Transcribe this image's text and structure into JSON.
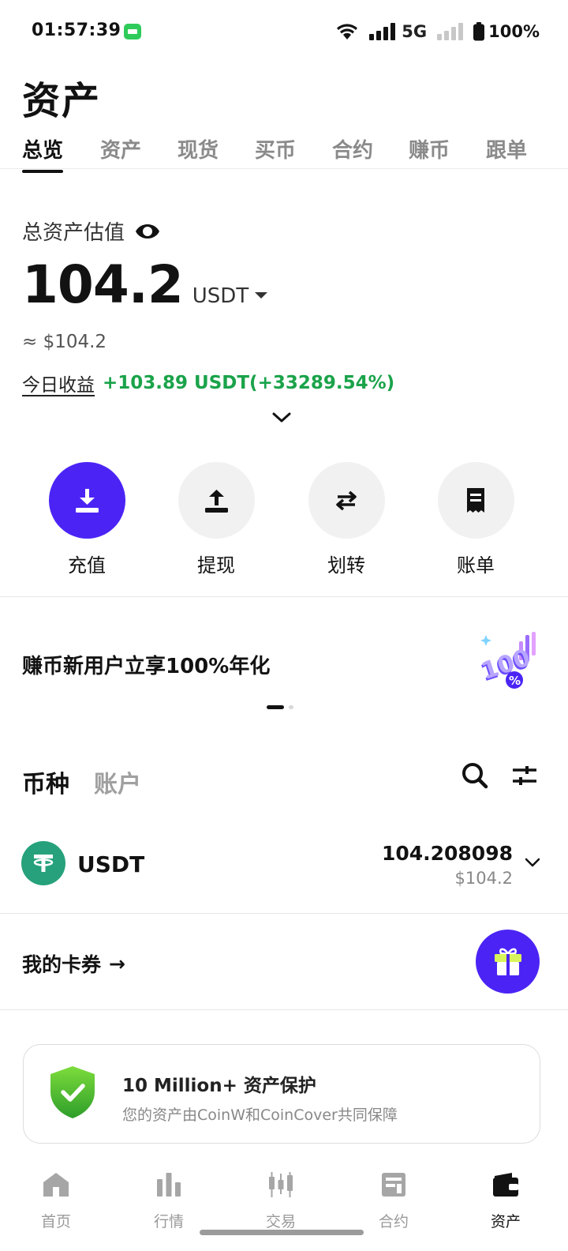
{
  "status_bar": {
    "time": "01:57:39",
    "network": "5G",
    "battery": "100%"
  },
  "header": {
    "title": "资产"
  },
  "tabs": [
    {
      "label": "总览",
      "active": true
    },
    {
      "label": "资产",
      "active": false
    },
    {
      "label": "现货",
      "active": false
    },
    {
      "label": "买币",
      "active": false
    },
    {
      "label": "合约",
      "active": false
    },
    {
      "label": "赚币",
      "active": false
    },
    {
      "label": "跟单",
      "active": false
    }
  ],
  "total": {
    "label": "总资产估值",
    "value": "104.2",
    "unit": "USDT",
    "approx": "≈ $104.2",
    "pnl_label": "今日收益",
    "pnl_value": "+103.89 USDT(+33289.54%)"
  },
  "actions": [
    {
      "label": "充值",
      "icon": "download-icon"
    },
    {
      "label": "提现",
      "icon": "upload-icon"
    },
    {
      "label": "划转",
      "icon": "transfer-icon"
    },
    {
      "label": "账单",
      "icon": "bill-icon"
    }
  ],
  "banner": {
    "text": "赚币新用户立享100%年化",
    "pages": 2,
    "active_page": 1
  },
  "asset_tabs": [
    {
      "label": "币种",
      "active": true
    },
    {
      "label": "账户",
      "active": false
    }
  ],
  "coins": [
    {
      "name": "USDT",
      "amount": "104.208098",
      "fiat": "$104.2",
      "icon": "tether-icon"
    }
  ],
  "coupons": {
    "label": "我的卡券",
    "arrow": "→"
  },
  "protection": {
    "title": "10 Million+ 资产保护",
    "subtitle": "您的资产由CoinW和CoinCover共同保障"
  },
  "bottom_nav": [
    {
      "label": "首页",
      "icon": "home-icon",
      "active": false
    },
    {
      "label": "行情",
      "icon": "market-icon",
      "active": false
    },
    {
      "label": "交易",
      "icon": "trade-icon",
      "active": false
    },
    {
      "label": "合约",
      "icon": "futures-icon",
      "active": false
    },
    {
      "label": "资产",
      "icon": "wallet-icon",
      "active": true
    }
  ],
  "colors": {
    "primary": "#4b24f5",
    "positive": "#1aa34a",
    "text": "#121212",
    "muted": "#8a8a8a"
  }
}
